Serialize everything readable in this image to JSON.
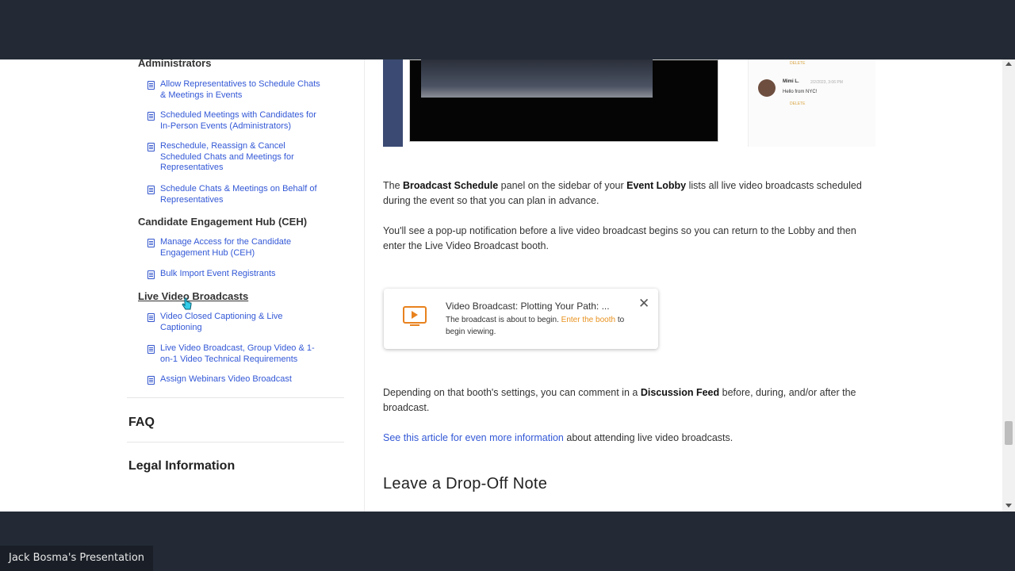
{
  "sidebar": {
    "section_administrators": "Administrators",
    "admin_items": [
      "Allow Representatives to Schedule Chats & Meetings in Events",
      "Scheduled Meetings with Candidates for In-Person Events (Administrators)",
      "Reschedule, Reassign & Cancel Scheduled Chats and Meetings for Representatives",
      "Schedule Chats & Meetings on Behalf of Representatives"
    ],
    "section_ceh": "Candidate Engagement Hub (CEH)",
    "ceh_items": [
      "Manage Access for the Candidate Engagement Hub (CEH)",
      "Bulk Import Event Registrants"
    ],
    "section_live_video": "Live Video Broadcasts",
    "live_video_items": [
      "Video Closed Captioning & Live Captioning",
      "Live Video Broadcast, Group Video & 1-on-1 Video Technical Requirements",
      "Assign Webinars Video Broadcast"
    ],
    "faq": "FAQ",
    "legal": "Legal Information"
  },
  "screenshot_chat": {
    "name": "Mimi L.",
    "time": "2/2/2023, 3:06 PM",
    "message": "Hello from NYC!",
    "delete_label": "DELETE"
  },
  "main": {
    "para1": {
      "t1": "The ",
      "b1": "Broadcast Schedule",
      "t2": " panel on the sidebar of your ",
      "b2": "Event Lobby",
      "t3": " lists all live video broadcasts scheduled during the event so that you can plan in advance."
    },
    "para2": "You'll see a pop-up notification before a live video broadcast begins so you can return to the Lobby and then enter the Live Video Broadcast booth.",
    "notification": {
      "title": "Video Broadcast: Plotting Your Path: ...",
      "body_start": "The broadcast is about to begin. ",
      "body_link": "Enter the booth",
      "body_end": " to begin viewing.",
      "close": "✕"
    },
    "para3": {
      "t1": "Depending on that booth's settings, you can comment in a ",
      "b1": "Discussion Feed",
      "t2": " before, during, and/or after the broadcast."
    },
    "para4": {
      "link": "See this article for even more information",
      "rest": " about attending live video broadcasts."
    },
    "heading": "Leave a Drop-Off Note"
  },
  "presenter_label": "Jack Bosma's Presentation"
}
